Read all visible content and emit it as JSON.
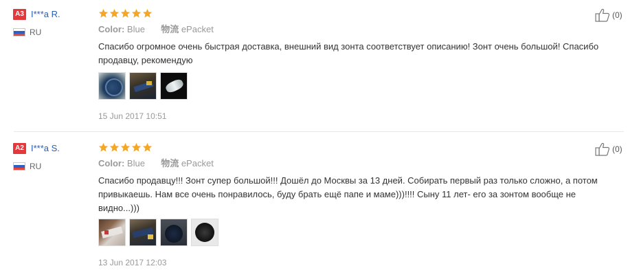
{
  "reviews": [
    {
      "badge": "A3",
      "user": "I***a R.",
      "country": "RU",
      "rating": 5,
      "color_label": "Color:",
      "color_value": "Blue",
      "shipping_label": "物流",
      "shipping_value": "ePacket",
      "text": "Спасибо огромное очень быстрая доставка, внешний вид зонта соответствует описанию! Зонт очень большой! Спасибо продавцу, рекомендую",
      "photos": [
        "photo-1",
        "photo-2",
        "photo-3"
      ],
      "date": "15 Jun 2017 10:51",
      "helpful_count": "(0)"
    },
    {
      "badge": "A2",
      "user": "I***a S.",
      "country": "RU",
      "rating": 5,
      "color_label": "Color:",
      "color_value": "Blue",
      "shipping_label": "物流",
      "shipping_value": "ePacket",
      "text": "Спасибо продавцу!!! Зонт супер большой!!! Дошёл до Москвы за 13 дней. Собирать первый раз только сложно, а потом привыкаешь. Нам все очень понравилось, буду брать ещё папе и маме)))!!!! Сыну 11 лет- его за зонтом вообще не видно...)))",
      "photos": [
        "photo-1",
        "photo-2",
        "photo-3",
        "photo-4"
      ],
      "date": "13 Jun 2017 12:03",
      "helpful_count": "(0)"
    }
  ],
  "colors": {
    "badge": "#e4393c",
    "username": "#2a5db0",
    "star": "#f5a623",
    "muted": "#999999"
  },
  "icons": {
    "star": "star-icon",
    "flag": "russia-flag-icon",
    "helpful": "thumbs-up-icon"
  }
}
